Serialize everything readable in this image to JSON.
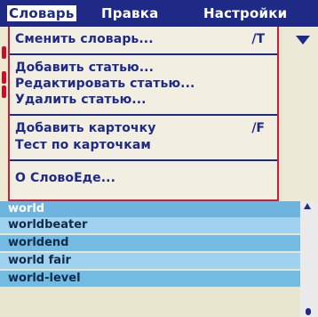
{
  "menubar": {
    "menus": [
      {
        "label": "Словарь"
      },
      {
        "label": "Правка"
      },
      {
        "label": "Настройки"
      }
    ]
  },
  "dropdown": {
    "items": [
      {
        "label": "Сменить словарь...",
        "shortcut": "/T"
      },
      {
        "label": "Добавить статью..."
      },
      {
        "label": "Редактировать статью..."
      },
      {
        "label": "Удалить статью..."
      },
      {
        "label": "Добавить карточку",
        "shortcut": "/F"
      },
      {
        "label": "Тест по карточкам"
      },
      {
        "label": "О СловоЕде..."
      }
    ]
  },
  "list": {
    "items": [
      "world",
      "worldbeater",
      "worldend",
      "world fair",
      "world-level"
    ]
  },
  "colors": {
    "menubar_bg": "#1e2a86",
    "menu_text": "#1d2a87",
    "menu_border": "#c7203a",
    "list_highlight": "#6db4de",
    "list_row": "#9fd2ee"
  },
  "icons": [
    "dropdown-arrow-icon",
    "scroll-up-icon",
    "scroll-thumb-icon"
  ]
}
